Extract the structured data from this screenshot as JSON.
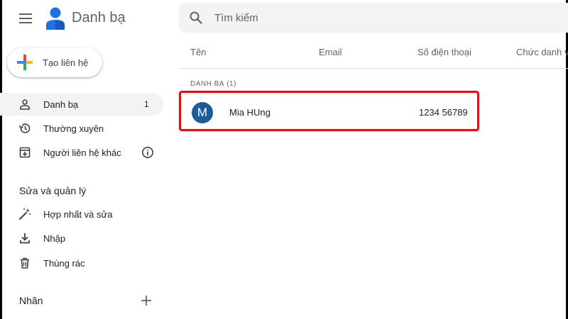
{
  "header": {
    "app_title": "Danh bạ",
    "search_placeholder": "Tìm kiếm"
  },
  "sidebar": {
    "create_label": "Tạo liên hệ",
    "items": [
      {
        "label": "Danh bạ",
        "count": "1",
        "icon": "person-icon",
        "active": true
      },
      {
        "label": "Thường xuyên",
        "icon": "history-icon"
      },
      {
        "label": "Người liên hệ khác",
        "icon": "archive-download-icon",
        "info_icon": "info-icon"
      }
    ],
    "manage_title": "Sửa và quản lý",
    "manage_items": [
      {
        "label": "Hợp nhất và sửa",
        "icon": "magic-wand-icon"
      },
      {
        "label": "Nhập",
        "icon": "download-icon"
      },
      {
        "label": "Thùng rác",
        "icon": "trash-icon"
      }
    ],
    "labels_title": "Nhãn"
  },
  "table": {
    "columns": [
      "Tên",
      "Email",
      "Số điện thoại",
      "Chức danh và"
    ],
    "group_label": "DANH BẠ (1)",
    "rows": [
      {
        "avatar_letter": "M",
        "name": "Mia HUng",
        "email": "",
        "phone": "1234 56789"
      }
    ]
  },
  "colors": {
    "highlight_border": "#d7141a",
    "avatar_bg": "#1e5b99",
    "active_nav_bg": "#f1f3f4",
    "search_bg": "#f1f3f4"
  }
}
